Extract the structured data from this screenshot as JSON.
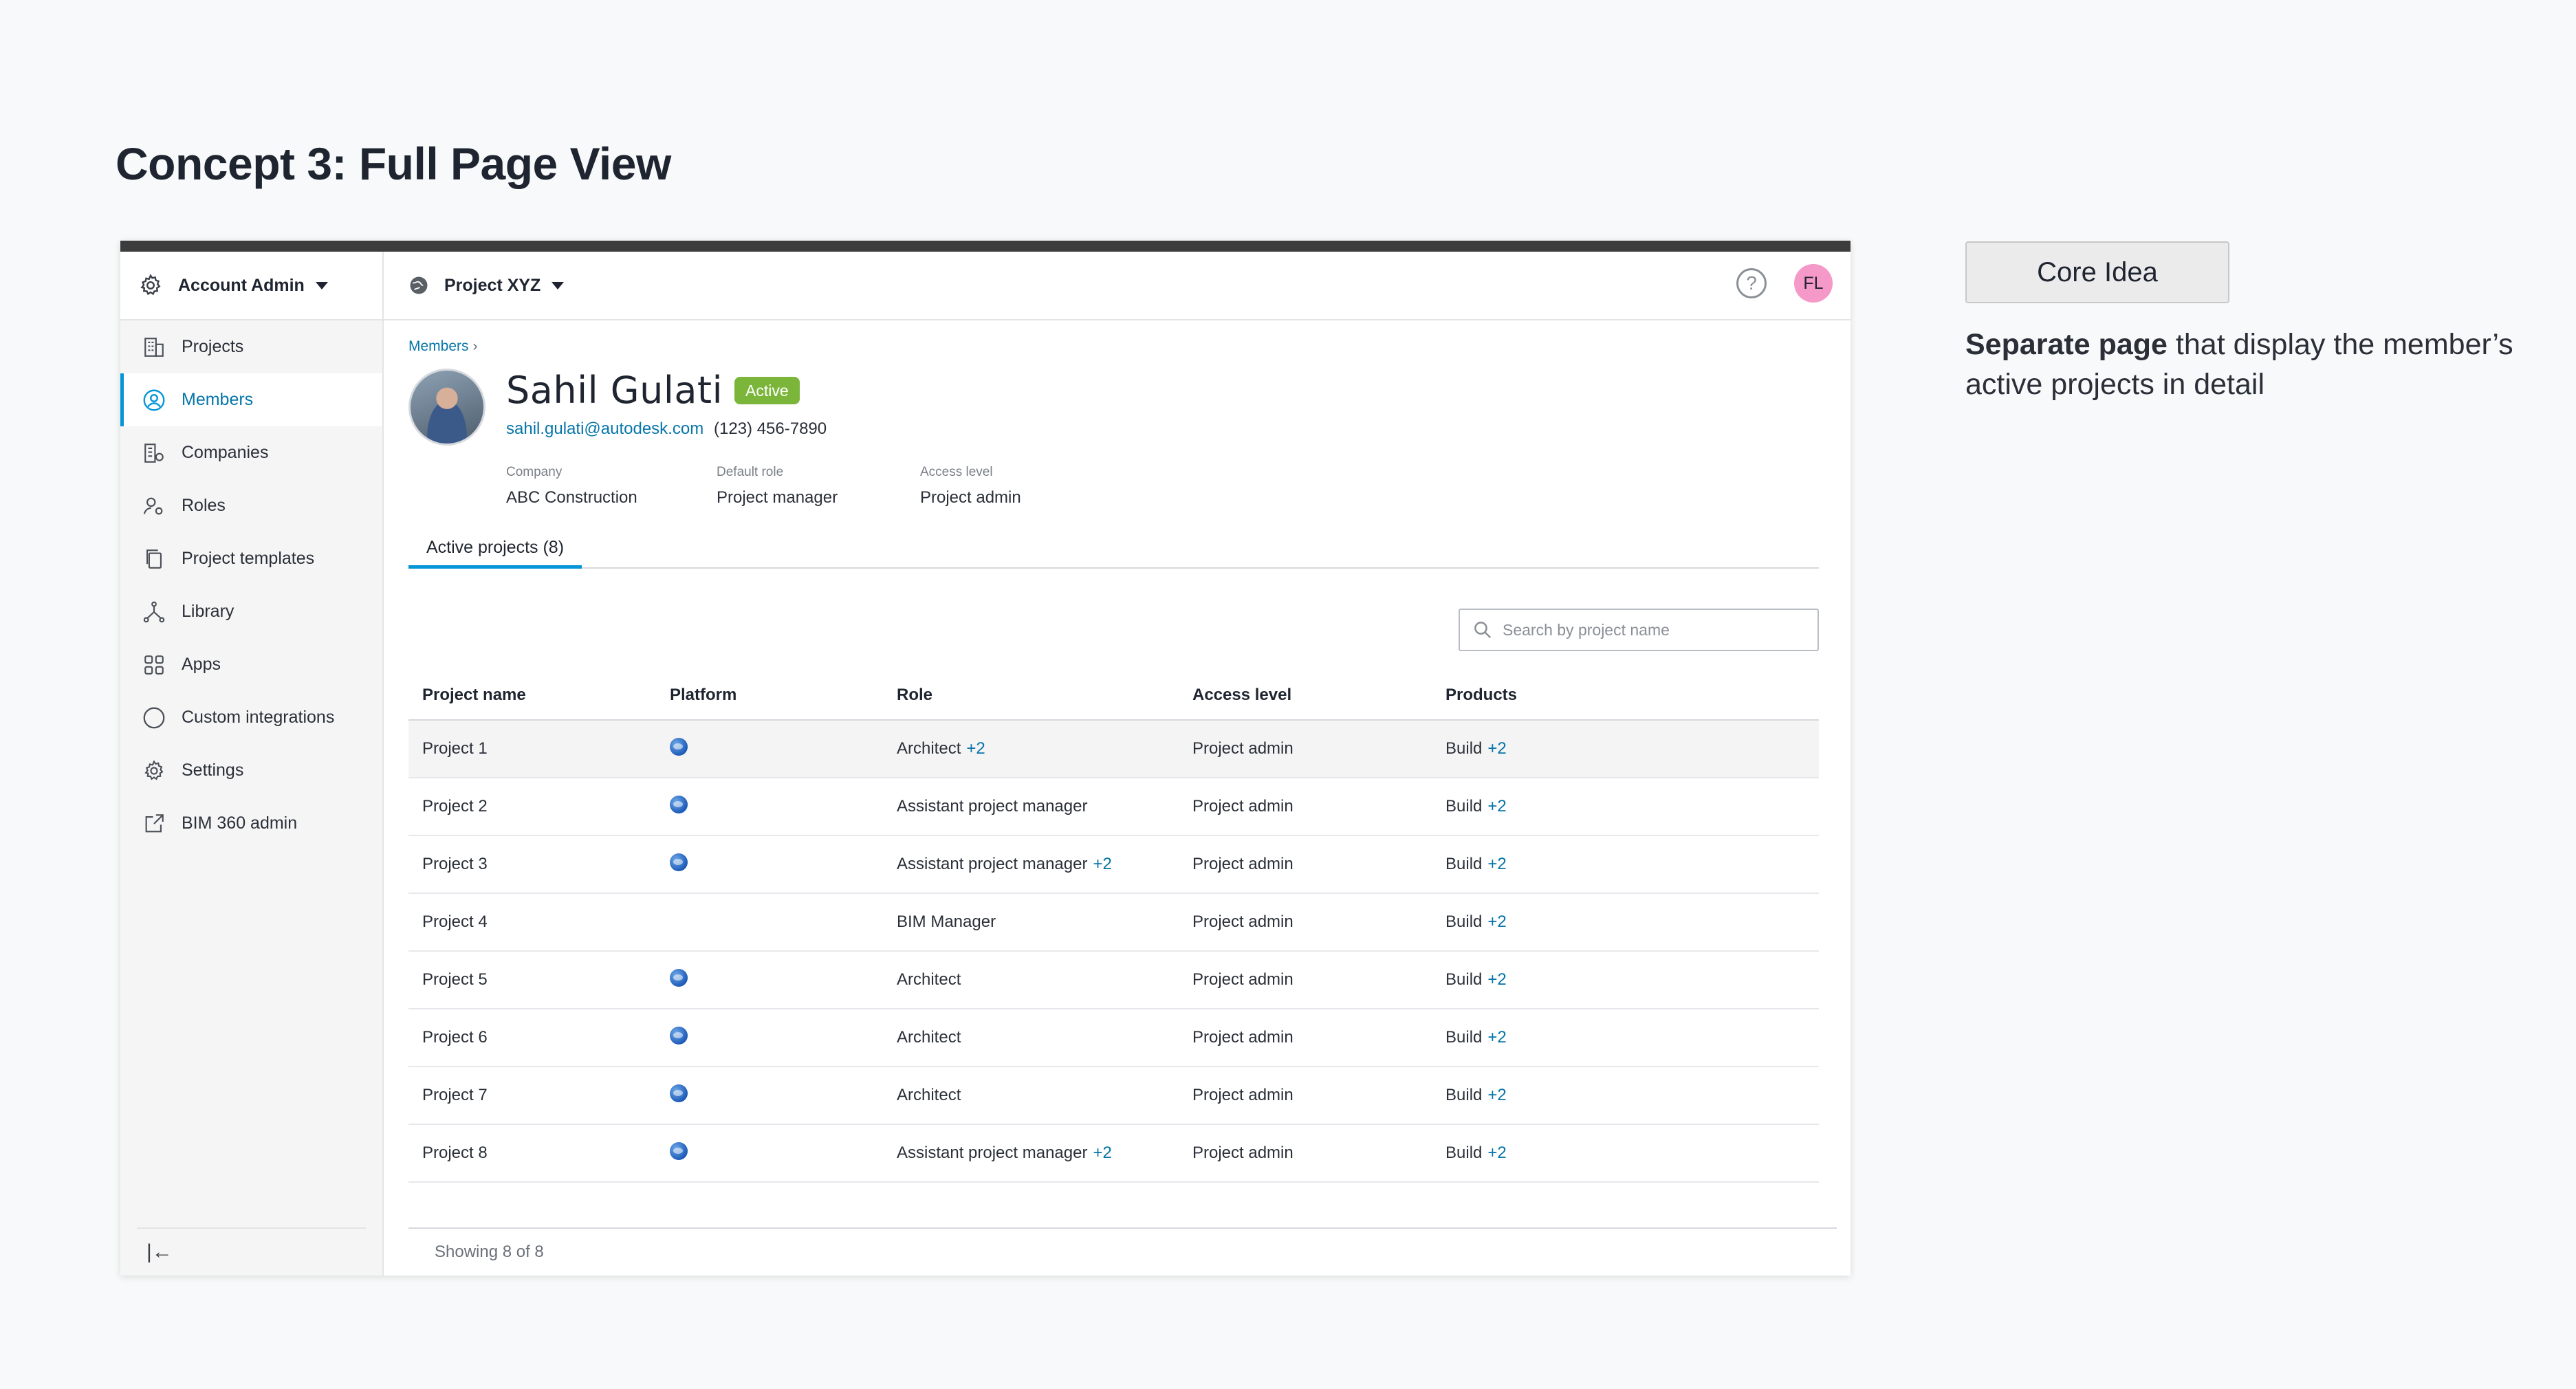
{
  "page": {
    "title": "Concept 3: Full Page View"
  },
  "annotation": {
    "button_label": "Core Idea",
    "desc_bold": "Separate page",
    "desc_rest": " that display the member’s active projects in detail"
  },
  "sidebar": {
    "account_label": "Account Admin",
    "items": [
      {
        "label": "Projects",
        "icon": "building-icon",
        "active": false
      },
      {
        "label": "Members",
        "icon": "user-circle-icon",
        "active": true
      },
      {
        "label": "Companies",
        "icon": "company-icon",
        "active": false
      },
      {
        "label": "Roles",
        "icon": "user-gear-icon",
        "active": false
      },
      {
        "label": "Project templates",
        "icon": "copy-icon",
        "active": false
      },
      {
        "label": "Library",
        "icon": "network-icon",
        "active": false
      },
      {
        "label": "Apps",
        "icon": "grid-icon",
        "active": false
      },
      {
        "label": "Custom integrations",
        "icon": "circle-icon",
        "active": false
      },
      {
        "label": "Settings",
        "icon": "gear-icon",
        "active": false
      },
      {
        "label": "BIM 360 admin",
        "icon": "external-link-icon",
        "active": false
      }
    ],
    "collapse_glyph": "|←"
  },
  "topbar": {
    "project_label": "Project XYZ",
    "help_glyph": "?",
    "avatar_initials": "FL",
    "avatar_color": "#f599c8"
  },
  "member": {
    "breadcrumb": "Members",
    "name": "Sahil Gulati",
    "status": "Active",
    "status_color": "#7bb63a",
    "email": "sahil.gulati@autodesk.com",
    "phone": "(123) 456-7890",
    "company_label": "Company",
    "company": "ABC Construction",
    "role_label": "Default role",
    "role": "Project manager",
    "access_label": "Access level",
    "access": "Project admin"
  },
  "tabs": {
    "active_projects": "Active projects (8)"
  },
  "search": {
    "placeholder": "Search by project name"
  },
  "table": {
    "headers": {
      "name": "Project name",
      "platform": "Platform",
      "role": "Role",
      "access": "Access level",
      "products": "Products"
    },
    "rows": [
      {
        "name": "Project 1",
        "platform": true,
        "role": "Architect",
        "role_more": "+2",
        "access": "Project admin",
        "product": "Build",
        "product_more": "+2"
      },
      {
        "name": "Project 2",
        "platform": true,
        "role": "Assistant project manager",
        "role_more": "",
        "access": "Project admin",
        "product": "Build",
        "product_more": "+2"
      },
      {
        "name": "Project 3",
        "platform": true,
        "role": "Assistant project manager",
        "role_more": "+2",
        "access": "Project admin",
        "product": "Build",
        "product_more": "+2"
      },
      {
        "name": "Project 4",
        "platform": false,
        "role": "BIM Manager",
        "role_more": "",
        "access": "Project admin",
        "product": "Build",
        "product_more": "+2"
      },
      {
        "name": "Project 5",
        "platform": true,
        "role": "Architect",
        "role_more": "",
        "access": "Project admin",
        "product": "Build",
        "product_more": "+2"
      },
      {
        "name": "Project 6",
        "platform": true,
        "role": "Architect",
        "role_more": "",
        "access": "Project admin",
        "product": "Build",
        "product_more": "+2"
      },
      {
        "name": "Project 7",
        "platform": true,
        "role": "Architect",
        "role_more": "",
        "access": "Project admin",
        "product": "Build",
        "product_more": "+2"
      },
      {
        "name": "Project 8",
        "platform": true,
        "role": "Assistant project manager",
        "role_more": "+2",
        "access": "Project admin",
        "product": "Build",
        "product_more": "+2"
      }
    ],
    "footer": "Showing 8 of 8"
  },
  "colors": {
    "accent": "#0696d7",
    "link": "#0675a9"
  }
}
